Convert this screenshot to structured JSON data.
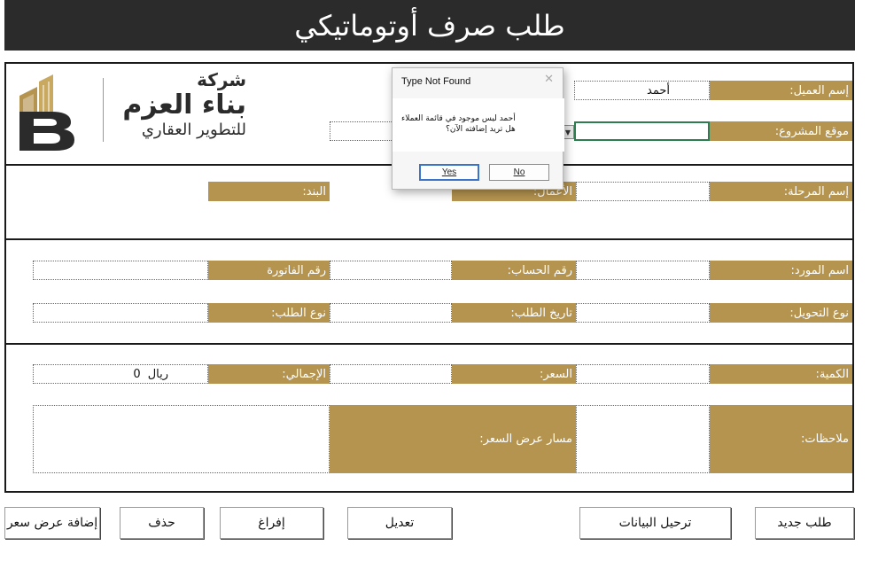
{
  "header": {
    "title": "طلب صرف أوتوماتيكي"
  },
  "logo": {
    "line1": "شركة",
    "line2": "بناء العزم",
    "line3": "للتطوير العقاري"
  },
  "section1": {
    "customer_name_label": "إسم العميل:",
    "customer_name_value": "أحمد",
    "project_location_label": "موقع المشروع:",
    "project_location_value": ""
  },
  "section2": {
    "stage_name_label": "إسم المرحلة:",
    "works_label": "الأعمال:",
    "item_label": "البند:"
  },
  "section3": {
    "supplier_name_label": "اسم المورد:",
    "account_number_label": "رقم الحساب:",
    "invoice_number_label": "رقم الفاتورة",
    "transfer_type_label": "نوع التحويل:",
    "request_date_label": "تاريخ الطلب:",
    "request_type_label": "نوع الطلب:"
  },
  "section4": {
    "quantity_label": "الكمية:",
    "price_label": "السعر:",
    "total_label": "الإجمالي:",
    "total_value": "0",
    "currency": "ريال",
    "notes_label": "ملاحظات:",
    "quote_path_label": "مسار عرض السعر:"
  },
  "buttons": {
    "new_request": "طلب جديد",
    "post_data": "ترحيل البيانات",
    "edit": "تعديل",
    "clear": "إفراغ",
    "delete": "حذف",
    "add_quote": "إضافة عرض سعر"
  },
  "dialog": {
    "title": "Type Not Found",
    "message_line1": "أحمد ليس موجود في قائمة العملاء",
    "message_line2": "هل تريد إضافته الآن؟",
    "yes_label": "Yes",
    "no_label": "No"
  },
  "colors": {
    "label_bg": "#b5944f",
    "header_bg": "#2b2b2b",
    "active_border": "#2e7d4f"
  }
}
